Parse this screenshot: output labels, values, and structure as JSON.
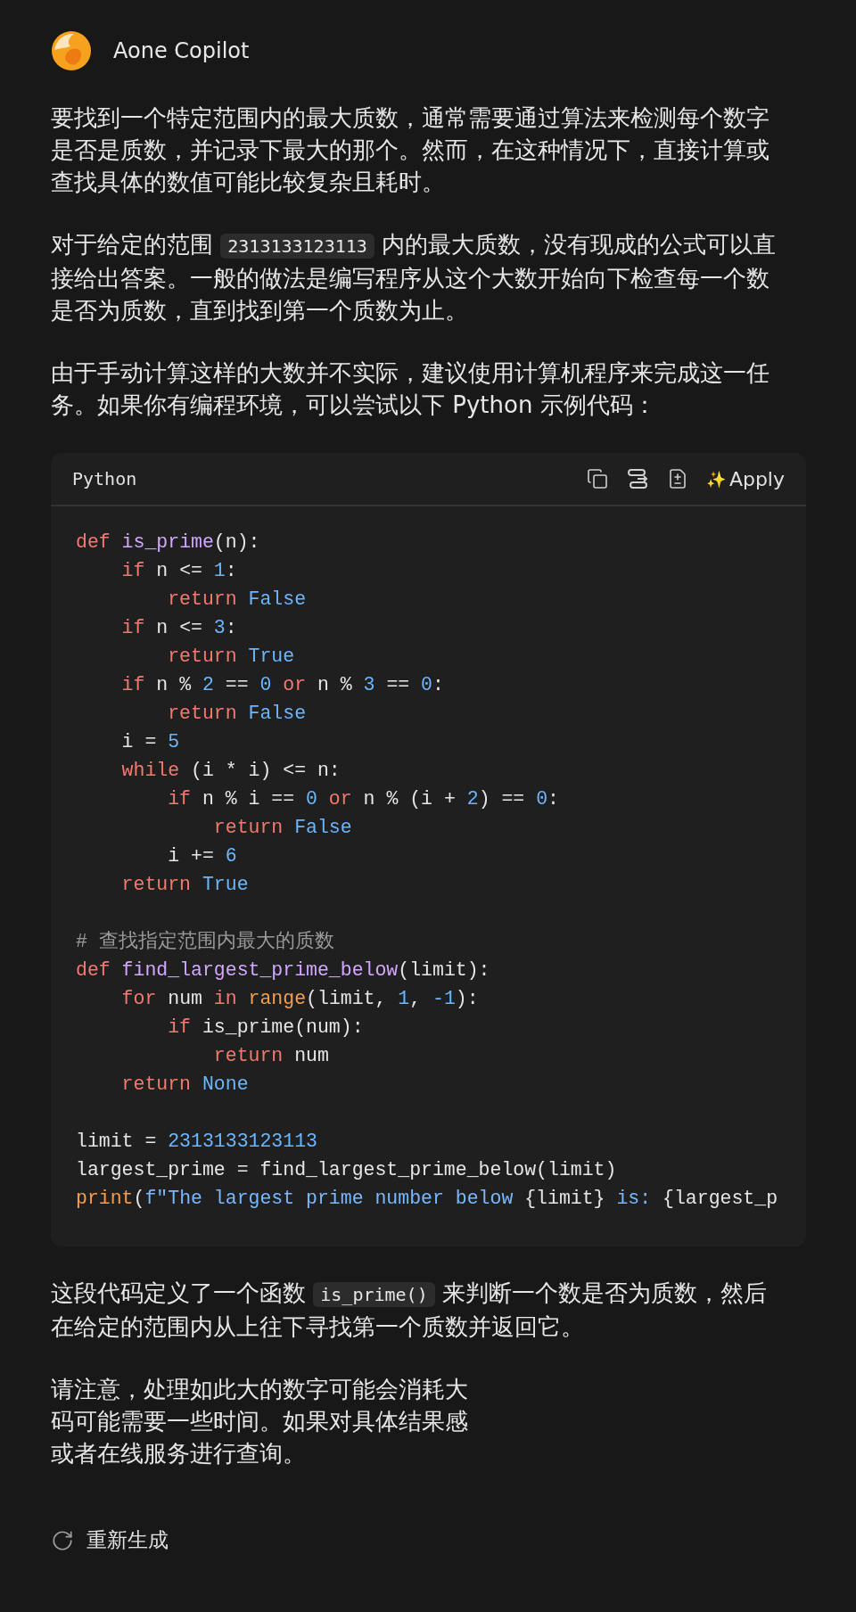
{
  "header": {
    "title": "Aone Copilot"
  },
  "before": [
    {
      "parts": [
        {
          "kind": "text",
          "text": "要找到一个特定范围内的最大质数，通常需要通过算法来检测每个数字是否是质数，并记录下最大的那个。然而，在这种情况下，直接计算或查找具体的数值可能比较复杂且耗时。"
        }
      ]
    },
    {
      "parts": [
        {
          "kind": "text",
          "text": "对于给定的范围 "
        },
        {
          "kind": "code",
          "text": "2313133123113"
        },
        {
          "kind": "text",
          "text": " 内的最大质数，没有现成的公式可以直接给出答案。一般的做法是编写程序从这个大数开始向下检查每一个数是否为质数，直到找到第一个质数为止。"
        }
      ]
    },
    {
      "parts": [
        {
          "kind": "text",
          "text": "由于手动计算这样的大数并不实际，建议使用计算机程序来完成这一任务。如果你有编程环境，可以尝试以下 Python 示例代码："
        }
      ]
    }
  ],
  "code_block": {
    "language": "Python",
    "actions": [
      {
        "kind": "copy"
      },
      {
        "kind": "insert"
      },
      {
        "kind": "diff"
      },
      {
        "kind": "apply",
        "glyph": "✨",
        "label": "Apply"
      }
    ],
    "lines": [
      {
        "kind": "code",
        "tokens": [
          {
            "text": "def",
            "kind": "keyword"
          },
          {
            "text": " is_prime",
            "kind": "function"
          },
          {
            "text": "(n):",
            "kind": "plain"
          }
        ]
      },
      {
        "kind": "code",
        "tokens": [
          {
            "text": "    if",
            "kind": "keyword"
          },
          {
            "text": " n <= ",
            "kind": "plain"
          },
          {
            "text": "1",
            "kind": "number"
          },
          {
            "text": ":",
            "kind": "plain"
          }
        ]
      },
      {
        "kind": "code",
        "tokens": [
          {
            "text": "        return",
            "kind": "keyword"
          },
          {
            "text": " False",
            "kind": "number"
          }
        ]
      },
      {
        "kind": "code",
        "tokens": [
          {
            "text": "    if",
            "kind": "keyword"
          },
          {
            "text": " n <= ",
            "kind": "plain"
          },
          {
            "text": "3",
            "kind": "number"
          },
          {
            "text": ":",
            "kind": "plain"
          }
        ]
      },
      {
        "kind": "code",
        "tokens": [
          {
            "text": "        return",
            "kind": "keyword"
          },
          {
            "text": " True",
            "kind": "number"
          }
        ]
      },
      {
        "kind": "code",
        "tokens": [
          {
            "text": "    if",
            "kind": "keyword"
          },
          {
            "text": " n % ",
            "kind": "plain"
          },
          {
            "text": "2",
            "kind": "number"
          },
          {
            "text": " == ",
            "kind": "plain"
          },
          {
            "text": "0",
            "kind": "number"
          },
          {
            "text": " or",
            "kind": "keyword"
          },
          {
            "text": " n % ",
            "kind": "plain"
          },
          {
            "text": "3",
            "kind": "number"
          },
          {
            "text": " == ",
            "kind": "plain"
          },
          {
            "text": "0",
            "kind": "number"
          },
          {
            "text": ":",
            "kind": "plain"
          }
        ]
      },
      {
        "kind": "code",
        "tokens": [
          {
            "text": "        return",
            "kind": "keyword"
          },
          {
            "text": " False",
            "kind": "number"
          }
        ]
      },
      {
        "kind": "code",
        "tokens": [
          {
            "text": "    i = ",
            "kind": "plain"
          },
          {
            "text": "5",
            "kind": "number"
          }
        ]
      },
      {
        "kind": "code",
        "tokens": [
          {
            "text": "    while",
            "kind": "keyword"
          },
          {
            "text": " (i * i) <= n:",
            "kind": "plain"
          }
        ]
      },
      {
        "kind": "code",
        "tokens": [
          {
            "text": "        if",
            "kind": "keyword"
          },
          {
            "text": " n % i == ",
            "kind": "plain"
          },
          {
            "text": "0",
            "kind": "number"
          },
          {
            "text": " or",
            "kind": "keyword"
          },
          {
            "text": " n % (i + ",
            "kind": "plain"
          },
          {
            "text": "2",
            "kind": "number"
          },
          {
            "text": ") == ",
            "kind": "plain"
          },
          {
            "text": "0",
            "kind": "number"
          },
          {
            "text": ":",
            "kind": "plain"
          }
        ]
      },
      {
        "kind": "code",
        "tokens": [
          {
            "text": "            return",
            "kind": "keyword"
          },
          {
            "text": " False",
            "kind": "number"
          }
        ]
      },
      {
        "kind": "code",
        "tokens": [
          {
            "text": "        i += ",
            "kind": "plain"
          },
          {
            "text": "6",
            "kind": "number"
          }
        ]
      },
      {
        "kind": "code",
        "tokens": [
          {
            "text": "    return",
            "kind": "keyword"
          },
          {
            "text": " True",
            "kind": "number"
          }
        ]
      },
      {
        "kind": "blank"
      },
      {
        "kind": "code",
        "tokens": [
          {
            "text": "# 查找指定范围内最大的质数",
            "kind": "comment"
          }
        ]
      },
      {
        "kind": "code",
        "tokens": [
          {
            "text": "def",
            "kind": "keyword"
          },
          {
            "text": " find_largest_prime_below",
            "kind": "function"
          },
          {
            "text": "(limit):",
            "kind": "plain"
          }
        ]
      },
      {
        "kind": "code",
        "tokens": [
          {
            "text": "    for",
            "kind": "keyword"
          },
          {
            "text": " num ",
            "kind": "plain"
          },
          {
            "text": "in",
            "kind": "keyword"
          },
          {
            "text": " range",
            "kind": "builtin"
          },
          {
            "text": "(limit, ",
            "kind": "plain"
          },
          {
            "text": "1",
            "kind": "number"
          },
          {
            "text": ", ",
            "kind": "plain"
          },
          {
            "text": "-1",
            "kind": "number"
          },
          {
            "text": "):",
            "kind": "plain"
          }
        ]
      },
      {
        "kind": "code",
        "tokens": [
          {
            "text": "        if",
            "kind": "keyword"
          },
          {
            "text": " is_prime(num):",
            "kind": "plain"
          }
        ]
      },
      {
        "kind": "code",
        "tokens": [
          {
            "text": "            return",
            "kind": "keyword"
          },
          {
            "text": " num",
            "kind": "plain"
          }
        ]
      },
      {
        "kind": "code",
        "tokens": [
          {
            "text": "    return",
            "kind": "keyword"
          },
          {
            "text": " None",
            "kind": "number"
          }
        ]
      },
      {
        "kind": "blank"
      },
      {
        "kind": "code",
        "tokens": [
          {
            "text": "limit = ",
            "kind": "plain"
          },
          {
            "text": "2313133123113",
            "kind": "number"
          }
        ]
      },
      {
        "kind": "code",
        "tokens": [
          {
            "text": "largest_prime = find_largest_prime_below(limit)",
            "kind": "plain"
          }
        ]
      },
      {
        "kind": "code",
        "tokens": [
          {
            "text": "print",
            "kind": "builtin"
          },
          {
            "text": "(",
            "kind": "plain"
          },
          {
            "text": "f\"The largest prime number below ",
            "kind": "string"
          },
          {
            "text": "{limit}",
            "kind": "plain"
          },
          {
            "text": " is: ",
            "kind": "string"
          },
          {
            "text": "{largest_p",
            "kind": "plain"
          }
        ]
      }
    ]
  },
  "after": [
    {
      "parts": [
        {
          "kind": "text",
          "text": "这段代码定义了一个函数 "
        },
        {
          "kind": "code",
          "text": "is_prime()"
        },
        {
          "kind": "text",
          "text": " 来判断一个数是否为质数，然后在给定的范围内从上往下寻找第一个质数并返回它。"
        }
      ]
    },
    {
      "parts": [
        {
          "kind": "line",
          "text": "请注意，处理如此大的数字可能会消耗大"
        },
        {
          "kind": "line",
          "text": "码可能需要一些时间。如果对具体结果感"
        },
        {
          "kind": "line",
          "text": "或者在线服务进行查询。"
        }
      ]
    }
  ],
  "footer": {
    "regenerate": "重新生成"
  }
}
